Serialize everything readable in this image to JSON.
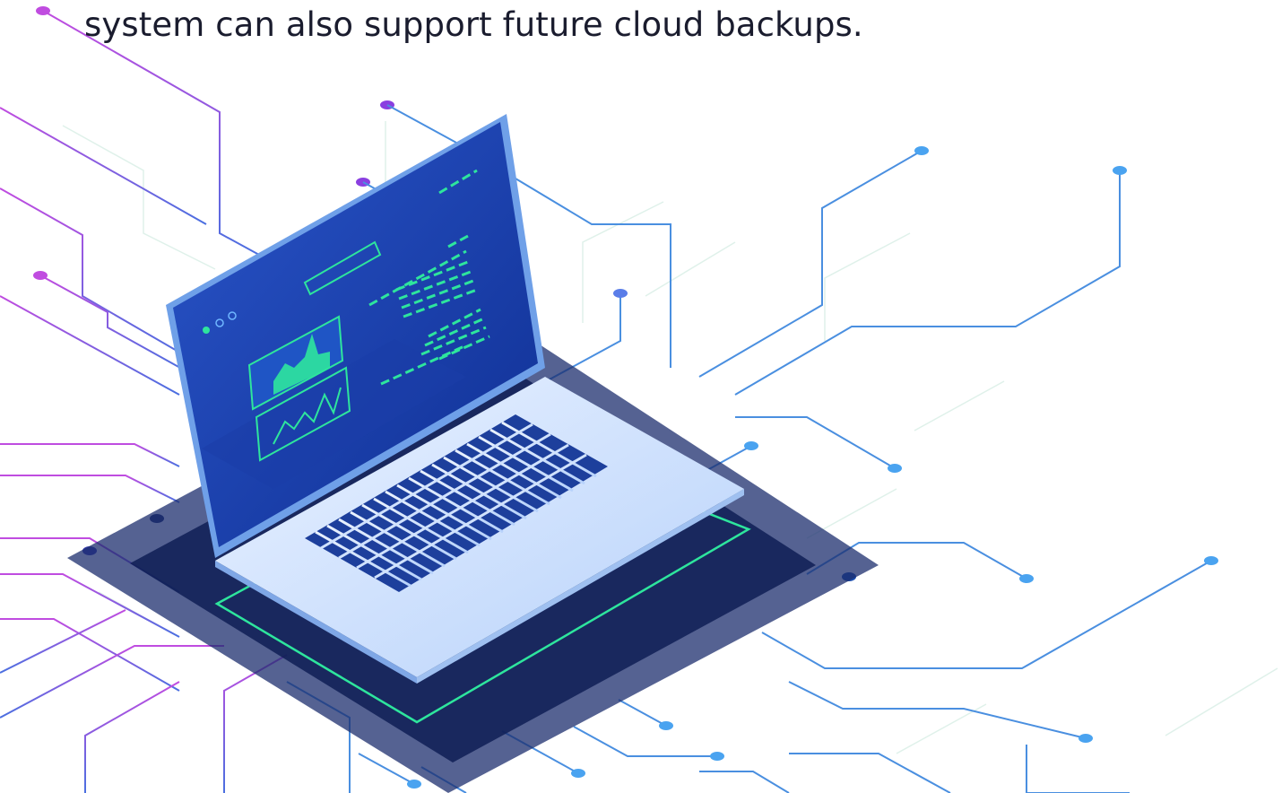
{
  "caption": {
    "text": "system can also support future cloud backups."
  },
  "illustration": {
    "subject": "laptop-on-circuit-board",
    "colors": {
      "screen": "#1f47b8",
      "screen_dark": "#0d2d8c",
      "body": "#d6e6ff",
      "keys": "#1d3f9c",
      "accent_green": "#2ee59d",
      "circuit_purple": "#b24de0",
      "circuit_blue": "#4a8fe0",
      "platform": "#1c2d6e"
    }
  }
}
